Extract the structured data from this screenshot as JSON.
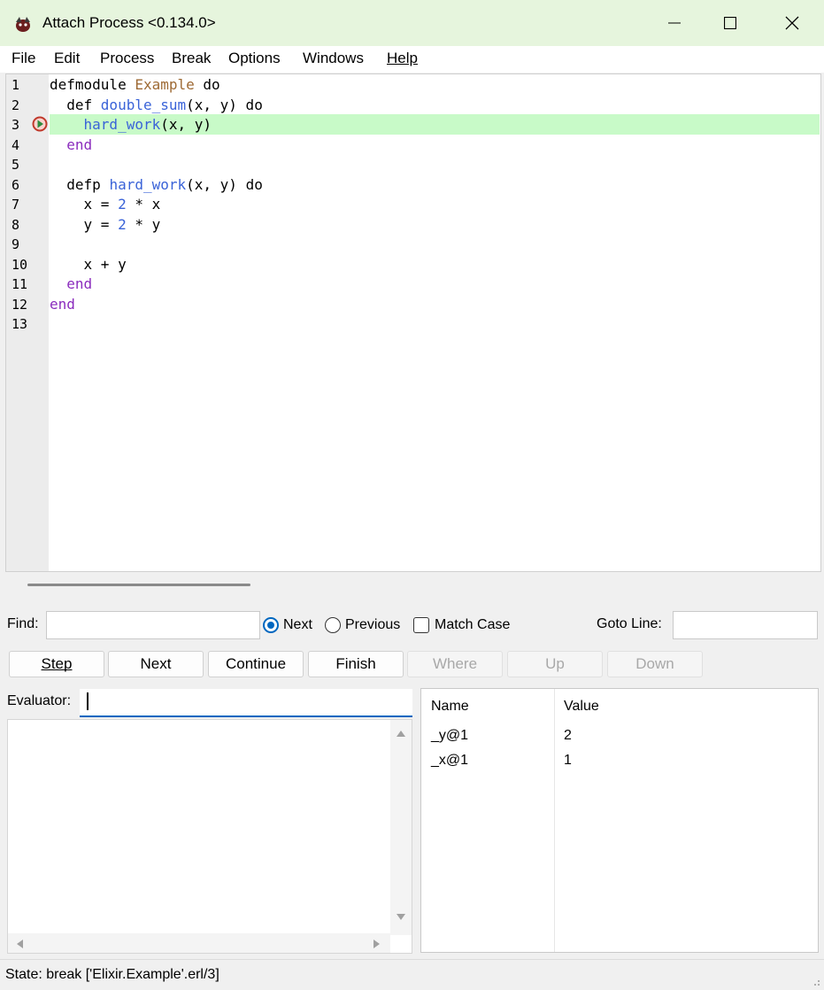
{
  "window": {
    "title": "Attach Process <0.134.0>",
    "titlebar_color": "#e6f5dd"
  },
  "menu": [
    "File",
    "Edit",
    "Process",
    "Break",
    "Options",
    "Windows",
    "Help"
  ],
  "editor": {
    "line_numbers": [
      "1",
      "2",
      "3",
      "4",
      "5",
      "6",
      "7",
      "8",
      "9",
      "10",
      "11",
      "12",
      "13"
    ],
    "current_line": 3,
    "lines": [
      [
        {
          "t": "defmodule ",
          "c": "kw"
        },
        {
          "t": "Example",
          "c": "mod"
        },
        {
          "t": " do",
          "c": "kw"
        }
      ],
      [
        {
          "t": "  def ",
          "c": "kw"
        },
        {
          "t": "double_sum",
          "c": "fn"
        },
        {
          "t": "(x, y) do",
          "c": "kw"
        }
      ],
      [
        {
          "t": "    ",
          "c": "kw"
        },
        {
          "t": "hard_work",
          "c": "fn"
        },
        {
          "t": "(x, y)",
          "c": "kw"
        }
      ],
      [
        {
          "t": "  end",
          "c": "endkw"
        }
      ],
      [],
      [
        {
          "t": "  defp ",
          "c": "kw"
        },
        {
          "t": "hard_work",
          "c": "fn"
        },
        {
          "t": "(x, y) do",
          "c": "kw"
        }
      ],
      [
        {
          "t": "    x = ",
          "c": "kw"
        },
        {
          "t": "2",
          "c": "num"
        },
        {
          "t": " * x",
          "c": "kw"
        }
      ],
      [
        {
          "t": "    y = ",
          "c": "kw"
        },
        {
          "t": "2",
          "c": "num"
        },
        {
          "t": " * y",
          "c": "kw"
        }
      ],
      [],
      [
        {
          "t": "    x + y",
          "c": "kw"
        }
      ],
      [
        {
          "t": "  end",
          "c": "endkw"
        }
      ],
      [
        {
          "t": "end",
          "c": "endkw"
        }
      ],
      []
    ]
  },
  "find": {
    "label": "Find:",
    "value": "",
    "next_label": "Next",
    "previous_label": "Previous",
    "match_case_label": "Match Case",
    "goto_label": "Goto Line:",
    "goto_value": ""
  },
  "buttons": {
    "step": "Step",
    "next": "Next",
    "continue": "Continue",
    "finish": "Finish",
    "where": "Where",
    "up": "Up",
    "down": "Down"
  },
  "evaluator": {
    "label": "Evaluator:",
    "value": ""
  },
  "bindings": {
    "headers": [
      "Name",
      "Value"
    ],
    "rows": [
      {
        "name": "_y@1",
        "value": "2"
      },
      {
        "name": "_x@1",
        "value": "1"
      }
    ]
  },
  "status": "State: break ['Elixir.Example'.erl/3]"
}
